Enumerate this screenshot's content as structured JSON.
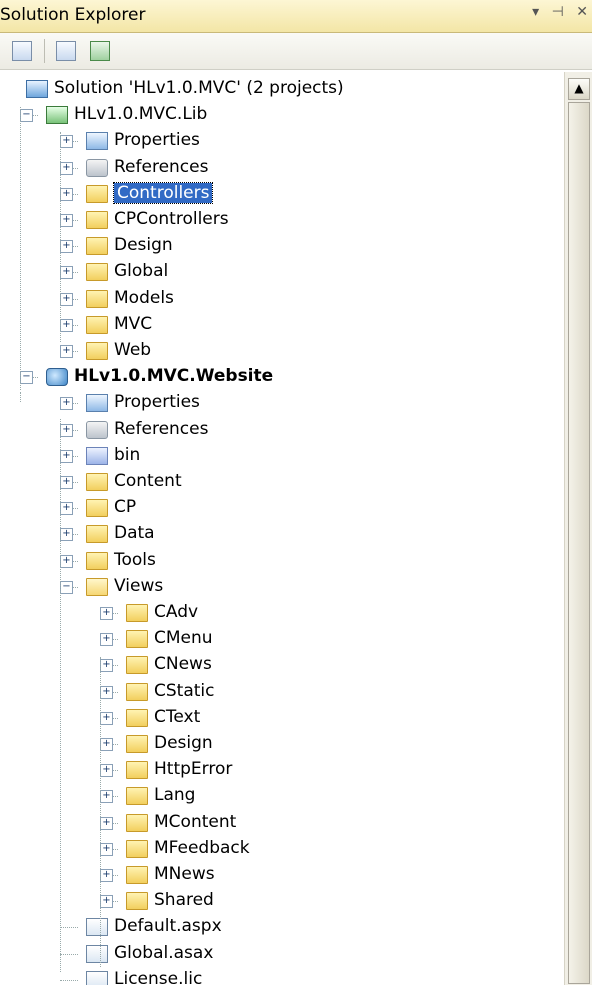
{
  "window": {
    "title": "Solution Explorer",
    "buttons": [
      "▾",
      "⊣",
      "✕"
    ]
  },
  "toolbar": {
    "buttons": [
      "show-all-files-icon",
      "properties-icon",
      "refresh-icon"
    ]
  },
  "tree": [
    {
      "label": "Solution 'HLv1.0.MVC' (2 projects)",
      "icon": "solution-icon",
      "expandable": false
    },
    {
      "label": "HLv1.0.MVC.Lib",
      "icon": "csharp-project-icon",
      "expandable": true,
      "expanded": true
    },
    {
      "label": "Properties",
      "icon": "properties-icon",
      "expandable": true,
      "expanded": false
    },
    {
      "label": "References",
      "icon": "references-icon",
      "expandable": true,
      "expanded": false
    },
    {
      "label": "Controllers",
      "icon": "folder-icon",
      "expandable": true,
      "expanded": false,
      "selected": true
    },
    {
      "label": "CPControllers",
      "icon": "folder-icon",
      "expandable": true,
      "expanded": false
    },
    {
      "label": "Design",
      "icon": "folder-icon",
      "expandable": true,
      "expanded": false
    },
    {
      "label": "Global",
      "icon": "folder-icon",
      "expandable": true,
      "expanded": false
    },
    {
      "label": "Models",
      "icon": "folder-icon",
      "expandable": true,
      "expanded": false
    },
    {
      "label": "MVC",
      "icon": "folder-icon",
      "expandable": true,
      "expanded": false
    },
    {
      "label": "Web",
      "icon": "folder-icon",
      "expandable": true,
      "expanded": false
    },
    {
      "label": "HLv1.0.MVC.Website",
      "icon": "web-project-icon",
      "expandable": true,
      "expanded": true,
      "bold": true
    },
    {
      "label": "Properties",
      "icon": "properties-icon",
      "expandable": true,
      "expanded": false
    },
    {
      "label": "References",
      "icon": "references-icon",
      "expandable": true,
      "expanded": false
    },
    {
      "label": "bin",
      "icon": "bin-folder-icon",
      "expandable": true,
      "expanded": false
    },
    {
      "label": "Content",
      "icon": "folder-icon",
      "expandable": true,
      "expanded": false
    },
    {
      "label": "CP",
      "icon": "folder-icon",
      "expandable": true,
      "expanded": false
    },
    {
      "label": "Data",
      "icon": "folder-icon",
      "expandable": true,
      "expanded": false
    },
    {
      "label": "Tools",
      "icon": "folder-icon",
      "expandable": true,
      "expanded": false
    },
    {
      "label": "Views",
      "icon": "open-folder-icon",
      "expandable": true,
      "expanded": true
    },
    {
      "label": "CAdv",
      "icon": "folder-icon",
      "expandable": true,
      "expanded": false
    },
    {
      "label": "CMenu",
      "icon": "folder-icon",
      "expandable": true,
      "expanded": false
    },
    {
      "label": "CNews",
      "icon": "folder-icon",
      "expandable": true,
      "expanded": false
    },
    {
      "label": "CStatic",
      "icon": "folder-icon",
      "expandable": true,
      "expanded": false
    },
    {
      "label": "CText",
      "icon": "folder-icon",
      "expandable": true,
      "expanded": false
    },
    {
      "label": "Design",
      "icon": "folder-icon",
      "expandable": true,
      "expanded": false
    },
    {
      "label": "HttpError",
      "icon": "folder-icon",
      "expandable": true,
      "expanded": false
    },
    {
      "label": "Lang",
      "icon": "folder-icon",
      "expandable": true,
      "expanded": false
    },
    {
      "label": "MContent",
      "icon": "folder-icon",
      "expandable": true,
      "expanded": false
    },
    {
      "label": "MFeedback",
      "icon": "folder-icon",
      "expandable": true,
      "expanded": false
    },
    {
      "label": "MNews",
      "icon": "folder-icon",
      "expandable": true,
      "expanded": false
    },
    {
      "label": "Shared",
      "icon": "folder-icon",
      "expandable": true,
      "expanded": false
    },
    {
      "label": "Default.aspx",
      "icon": "aspx-file-icon",
      "expandable": false
    },
    {
      "label": "Global.asax",
      "icon": "asax-file-icon",
      "expandable": false
    },
    {
      "label": "License.lic",
      "icon": "lic-file-icon",
      "expandable": false
    }
  ]
}
